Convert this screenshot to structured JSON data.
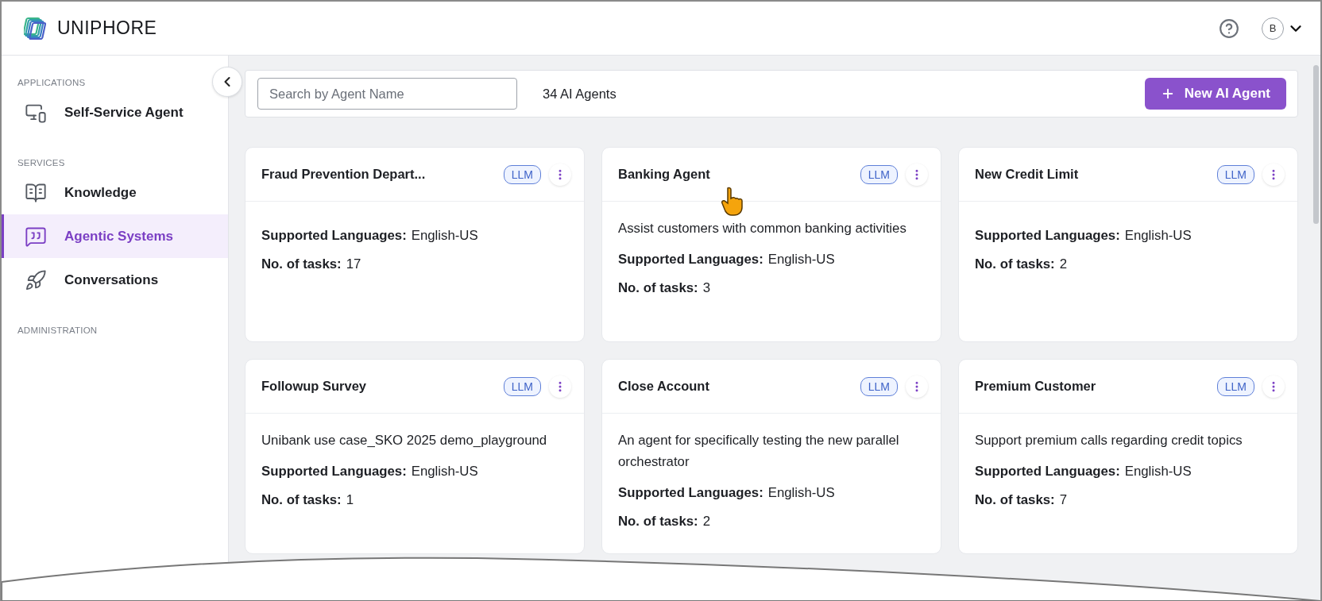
{
  "header": {
    "logo": "UNIPHORE",
    "avatar": "B"
  },
  "sidebar": {
    "sections": [
      {
        "title": "APPLICATIONS",
        "items": [
          {
            "label": "Self-Service Agent",
            "selected": false
          }
        ]
      },
      {
        "title": "SERVICES",
        "items": [
          {
            "label": "Knowledge",
            "selected": false
          },
          {
            "label": "Agentic Systems",
            "selected": true
          },
          {
            "label": "Conversations",
            "selected": false
          }
        ]
      },
      {
        "title": "ADMINISTRATION"
      }
    ]
  },
  "toolbar": {
    "search": {
      "placeholder": "Search by Agent Name"
    },
    "count": "34 AI Agents",
    "button": "New AI Agent"
  },
  "cards": [
    {
      "title": "Fraud Prevention Depart...",
      "badge": "LLM",
      "languages_label": "Supported Languages:",
      "languages": "English-US",
      "tasks_label": "No. of tasks:",
      "tasks": "17"
    },
    {
      "title": "Banking Agent",
      "badge": "LLM",
      "description": "Assist customers with common banking activities",
      "languages_label": "Supported Languages:",
      "languages": "English-US",
      "tasks_label": "No. of tasks:",
      "tasks": "3"
    },
    {
      "title": "New Credit Limit",
      "badge": "LLM",
      "languages_label": "Supported Languages:",
      "languages": "English-US",
      "tasks_label": "No. of tasks:",
      "tasks": "2"
    },
    {
      "title": "Followup Survey",
      "badge": "LLM",
      "description": "Unibank use case_SKO 2025 demo_playground",
      "languages_label": "Supported Languages:",
      "languages": "English-US",
      "tasks_label": "No. of tasks:",
      "tasks": "1"
    },
    {
      "title": "Close Account",
      "badge": "LLM",
      "description": "An agent for specifically testing the new parallel orchestrator",
      "languages_label": "Supported Languages:",
      "languages": "English-US",
      "tasks_label": "No. of tasks:",
      "tasks": "2"
    },
    {
      "title": "Premium Customer",
      "badge": "LLM",
      "description": "Support premium calls regarding credit topics",
      "languages_label": "Supported Languages:",
      "languages": "English-US",
      "tasks_label": "No. of tasks:",
      "tasks": "7"
    }
  ]
}
